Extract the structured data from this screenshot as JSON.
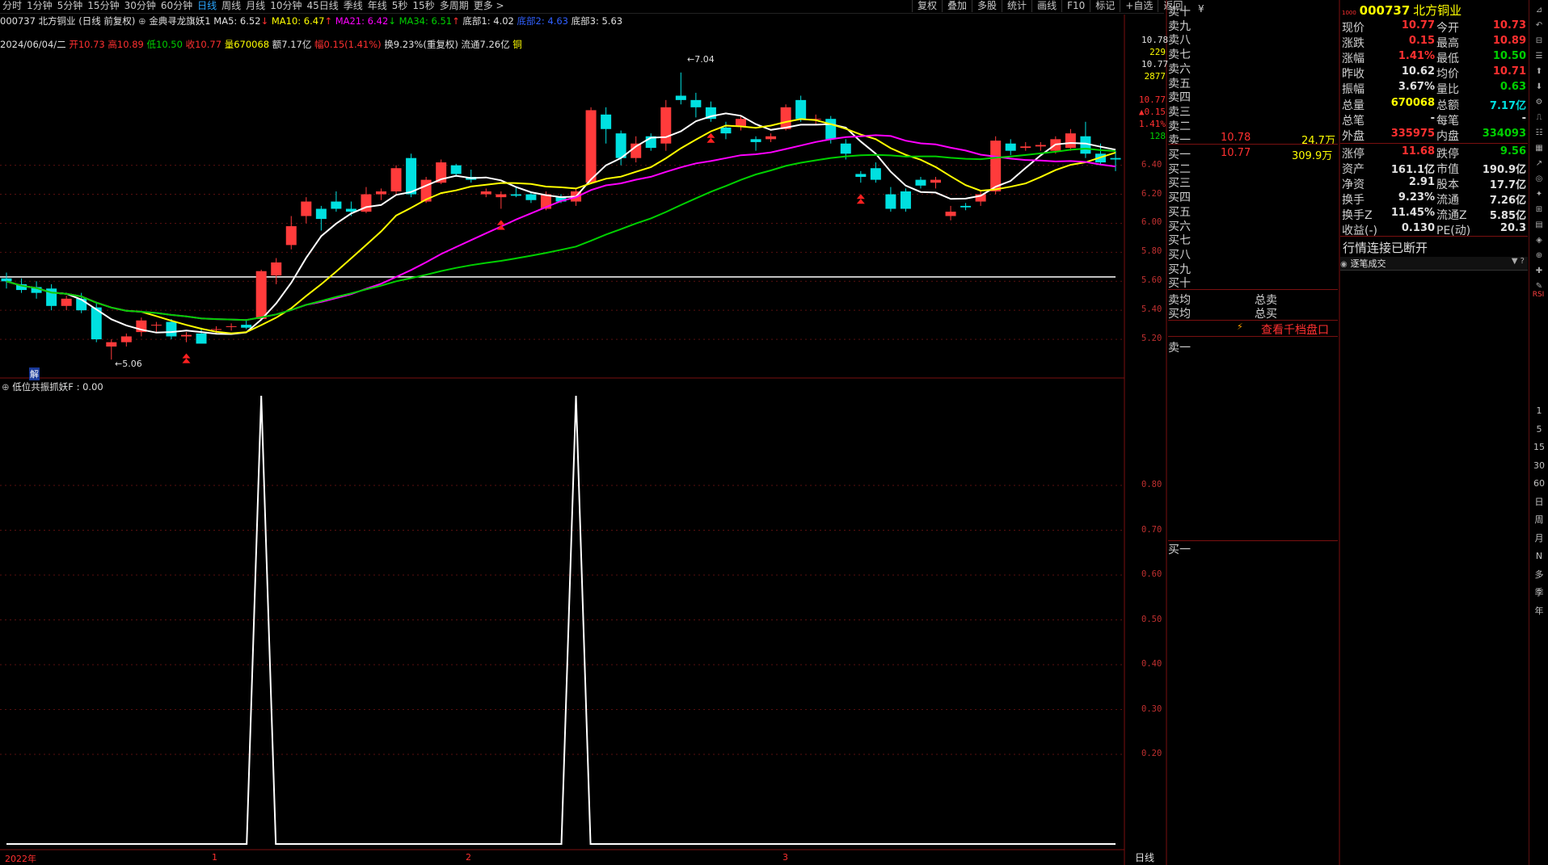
{
  "periods": [
    "分时",
    "1分钟",
    "5分钟",
    "15分钟",
    "30分钟",
    "60分钟",
    "日线",
    "周线",
    "月线",
    "10分钟",
    "45日线",
    "季线",
    "年线",
    "5秒",
    "15秒",
    "多周期",
    "更多 >"
  ],
  "active_period": "日线",
  "tools": [
    "复权",
    "叠加",
    "多股",
    "统计",
    "画线",
    "F10",
    "标记",
    "+自选",
    "返回"
  ],
  "stock": {
    "code": "000737",
    "name": "北方铜业",
    "mode": "(日线 前复权)"
  },
  "indicator_main": "金典寻龙旗妖1",
  "ma": {
    "ma5": "MA5: 6.52",
    "ma10": "MA10: 6.47",
    "ma21": "MA21: 6.42",
    "ma34": "MA34: 6.51",
    "bottom1": "底部1: 4.02",
    "bottom2": "底部2: 4.63",
    "bottom3": "底部3: 5.63"
  },
  "ohlc": {
    "date": "2024/06/04/二",
    "open": "开10.73",
    "high": "高10.89",
    "low": "低10.50",
    "close": "收10.77",
    "vol": "量670068",
    "amount": "额7.17亿",
    "change": "幅0.15(1.41%)",
    "turnover": "换9.23%(重复权)",
    "float": "流通7.26亿",
    "tag": "铜"
  },
  "price_axis": {
    "top": "10.78",
    "vol_a": "229",
    "price_b": "10.77",
    "vol_b": "2877",
    "price_c": "10.77",
    "chg": "▲0.15",
    "pct": "1.41%",
    "extra": "128",
    "ticks": [
      "6.40",
      "6.20",
      "6.00",
      "5.80",
      "5.60",
      "5.40",
      "5.20"
    ]
  },
  "annot": {
    "high": "7.04",
    "low": "5.06",
    "jie": "解"
  },
  "sub_indicator": "低位共振抓妖F : 0.00",
  "sub_axis": [
    "0.80",
    "0.70",
    "0.60",
    "0.50",
    "0.40",
    "0.30",
    "0.20"
  ],
  "date_axis": {
    "year": "2022年",
    "m1": "1",
    "m2": "2",
    "m3": "3",
    "period": "日线"
  },
  "orderbook": {
    "sells": [
      "卖十",
      "卖九",
      "卖八",
      "卖七",
      "卖六",
      "卖五",
      "卖四",
      "卖三",
      "卖二",
      "卖一"
    ],
    "sell_flag": "¥",
    "sell1_price": "10.78",
    "sell1_vol": "24.7万",
    "buys": [
      "买一",
      "买二",
      "买三",
      "买四",
      "买五",
      "买六",
      "买七",
      "买八",
      "买九",
      "买十"
    ],
    "buy1_price": "10.77",
    "buy1_vol": "309.9万",
    "avg_sell": "卖均",
    "total_sell": "总卖",
    "avg_buy": "买均",
    "total_buy": "总买",
    "thousand_link": "查看千档盘口",
    "box_sell1": "卖一",
    "box_buy1": "买一"
  },
  "quote": {
    "header_code": "000737",
    "header_name": "北方铜业",
    "rows": [
      {
        "l1": "现价",
        "v1": "10.77",
        "c1": "red",
        "l2": "今开",
        "v2": "10.73",
        "c2": "red"
      },
      {
        "l1": "涨跌",
        "v1": "0.15",
        "c1": "red",
        "l2": "最高",
        "v2": "10.89",
        "c2": "red"
      },
      {
        "l1": "涨幅",
        "v1": "1.41%",
        "c1": "red",
        "l2": "最低",
        "v2": "10.50",
        "c2": "green"
      },
      {
        "l1": "昨收",
        "v1": "10.62",
        "c1": "white",
        "l2": "均价",
        "v2": "10.71",
        "c2": "red"
      },
      {
        "l1": "振幅",
        "v1": "3.67%",
        "c1": "white",
        "l2": "量比",
        "v2": "0.63",
        "c2": "green"
      },
      {
        "l1": "总量",
        "v1": "670068",
        "c1": "yellow",
        "l2": "总额",
        "v2": "7.17亿",
        "c2": "cyan"
      },
      {
        "l1": "总笔",
        "v1": "-",
        "c1": "white",
        "l2": "每笔",
        "v2": "-",
        "c2": "white"
      },
      {
        "l1": "外盘",
        "v1": "335975",
        "c1": "red",
        "l2": "内盘",
        "v2": "334093",
        "c2": "green"
      },
      {
        "l1": "涨停",
        "v1": "11.68",
        "c1": "red",
        "l2": "跌停",
        "v2": "9.56",
        "c2": "green"
      },
      {
        "l1": "资产",
        "v1": "161.1亿",
        "c1": "white",
        "l2": "市值",
        "v2": "190.9亿",
        "c2": "white"
      },
      {
        "l1": "净资",
        "v1": "2.91",
        "c1": "white",
        "l2": "股本",
        "v2": "17.7亿",
        "c2": "white"
      },
      {
        "l1": "换手",
        "v1": "9.23%",
        "c1": "white",
        "l2": "流通",
        "v2": "7.26亿",
        "c2": "white"
      },
      {
        "l1": "换手Z",
        "v1": "11.45%",
        "c1": "white",
        "l2": "流通Z",
        "v2": "5.85亿",
        "c2": "white"
      },
      {
        "l1": "收益(-)",
        "v1": "0.130",
        "c1": "white",
        "l2": "PE(动)",
        "v2": "20.3",
        "c2": "white"
      }
    ],
    "status": "行情连接已断开",
    "trades_title": "逐笔成交"
  },
  "sidebar_icons": [
    "1",
    "5",
    "15",
    "30",
    "60",
    "日",
    "周",
    "月",
    "N",
    "多",
    "季",
    "年"
  ],
  "sidebar_misc": [
    "RSI"
  ],
  "colors": {
    "up": "#ff3b3b",
    "down": "#00e0e0",
    "ma5": "#ffffff",
    "ma10": "#ffff00",
    "ma21": "#ff00ff",
    "ma34": "#00d000",
    "grid": "#5a1010"
  },
  "chart_data": {
    "type": "candlestick",
    "candles": [
      {
        "o": 5.62,
        "h": 5.66,
        "l": 5.55,
        "c": 5.6
      },
      {
        "o": 5.58,
        "h": 5.62,
        "l": 5.52,
        "c": 5.54
      },
      {
        "o": 5.56,
        "h": 5.6,
        "l": 5.48,
        "c": 5.52
      },
      {
        "o": 5.55,
        "h": 5.58,
        "l": 5.4,
        "c": 5.43
      },
      {
        "o": 5.43,
        "h": 5.5,
        "l": 5.4,
        "c": 5.48
      },
      {
        "o": 5.48,
        "h": 5.52,
        "l": 5.38,
        "c": 5.4
      },
      {
        "o": 5.42,
        "h": 5.45,
        "l": 5.18,
        "c": 5.2
      },
      {
        "o": 5.15,
        "h": 5.2,
        "l": 5.06,
        "c": 5.18
      },
      {
        "o": 5.18,
        "h": 5.24,
        "l": 5.15,
        "c": 5.22
      },
      {
        "o": 5.25,
        "h": 5.35,
        "l": 5.22,
        "c": 5.33
      },
      {
        "o": 5.3,
        "h": 5.32,
        "l": 5.25,
        "c": 5.3
      },
      {
        "o": 5.32,
        "h": 5.34,
        "l": 5.2,
        "c": 5.22
      },
      {
        "o": 5.22,
        "h": 5.25,
        "l": 5.18,
        "c": 5.23
      },
      {
        "o": 5.24,
        "h": 5.28,
        "l": 5.17,
        "c": 5.17
      },
      {
        "o": 5.27,
        "h": 5.29,
        "l": 5.24,
        "c": 5.27
      },
      {
        "o": 5.29,
        "h": 5.31,
        "l": 5.26,
        "c": 5.29
      },
      {
        "o": 5.3,
        "h": 5.34,
        "l": 5.27,
        "c": 5.28
      },
      {
        "o": 5.34,
        "h": 5.68,
        "l": 5.33,
        "c": 5.67
      },
      {
        "o": 5.64,
        "h": 5.76,
        "l": 5.58,
        "c": 5.73
      },
      {
        "o": 5.85,
        "h": 6.05,
        "l": 5.82,
        "c": 5.98
      },
      {
        "o": 6.05,
        "h": 6.18,
        "l": 6.0,
        "c": 6.15
      },
      {
        "o": 6.1,
        "h": 6.12,
        "l": 5.95,
        "c": 6.03
      },
      {
        "o": 6.15,
        "h": 6.22,
        "l": 6.08,
        "c": 6.1
      },
      {
        "o": 6.1,
        "h": 6.15,
        "l": 6.05,
        "c": 6.08
      },
      {
        "o": 6.08,
        "h": 6.25,
        "l": 6.07,
        "c": 6.2
      },
      {
        "o": 6.2,
        "h": 6.24,
        "l": 6.16,
        "c": 6.22
      },
      {
        "o": 6.22,
        "h": 6.4,
        "l": 6.2,
        "c": 6.38
      },
      {
        "o": 6.45,
        "h": 6.48,
        "l": 6.18,
        "c": 6.2
      },
      {
        "o": 6.15,
        "h": 6.32,
        "l": 6.14,
        "c": 6.3
      },
      {
        "o": 6.28,
        "h": 6.44,
        "l": 6.27,
        "c": 6.42
      },
      {
        "o": 6.4,
        "h": 6.41,
        "l": 6.32,
        "c": 6.34
      },
      {
        "o": 6.32,
        "h": 6.37,
        "l": 6.28,
        "c": 6.3
      },
      {
        "o": 6.2,
        "h": 6.24,
        "l": 6.18,
        "c": 6.22
      },
      {
        "o": 6.18,
        "h": 6.22,
        "l": 6.1,
        "c": 6.2
      },
      {
        "o": 6.2,
        "h": 6.25,
        "l": 6.18,
        "c": 6.19
      },
      {
        "o": 6.2,
        "h": 6.22,
        "l": 6.14,
        "c": 6.16
      },
      {
        "o": 6.1,
        "h": 6.22,
        "l": 6.09,
        "c": 6.2
      },
      {
        "o": 6.18,
        "h": 6.2,
        "l": 6.14,
        "c": 6.15
      },
      {
        "o": 6.15,
        "h": 6.24,
        "l": 6.12,
        "c": 6.22
      },
      {
        "o": 6.28,
        "h": 6.8,
        "l": 6.27,
        "c": 6.78
      },
      {
        "o": 6.75,
        "h": 6.8,
        "l": 6.55,
        "c": 6.65
      },
      {
        "o": 6.62,
        "h": 6.64,
        "l": 6.4,
        "c": 6.45
      },
      {
        "o": 6.45,
        "h": 6.6,
        "l": 6.42,
        "c": 6.55
      },
      {
        "o": 6.6,
        "h": 6.62,
        "l": 6.5,
        "c": 6.52
      },
      {
        "o": 6.55,
        "h": 6.85,
        "l": 6.5,
        "c": 6.8
      },
      {
        "o": 6.88,
        "h": 7.04,
        "l": 6.82,
        "c": 6.85
      },
      {
        "o": 6.85,
        "h": 6.9,
        "l": 6.73,
        "c": 6.8
      },
      {
        "o": 6.8,
        "h": 6.84,
        "l": 6.7,
        "c": 6.72
      },
      {
        "o": 6.66,
        "h": 6.7,
        "l": 6.58,
        "c": 6.62
      },
      {
        "o": 6.67,
        "h": 6.74,
        "l": 6.64,
        "c": 6.72
      },
      {
        "o": 6.58,
        "h": 6.6,
        "l": 6.5,
        "c": 6.56
      },
      {
        "o": 6.58,
        "h": 6.62,
        "l": 6.56,
        "c": 6.6
      },
      {
        "o": 6.65,
        "h": 6.82,
        "l": 6.64,
        "c": 6.8
      },
      {
        "o": 6.85,
        "h": 6.88,
        "l": 6.7,
        "c": 6.72
      },
      {
        "o": 6.72,
        "h": 6.75,
        "l": 6.68,
        "c": 6.72
      },
      {
        "o": 6.72,
        "h": 6.74,
        "l": 6.55,
        "c": 6.58
      },
      {
        "o": 6.55,
        "h": 6.58,
        "l": 6.44,
        "c": 6.48
      },
      {
        "o": 6.34,
        "h": 6.36,
        "l": 6.28,
        "c": 6.32
      },
      {
        "o": 6.38,
        "h": 6.42,
        "l": 6.28,
        "c": 6.3
      },
      {
        "o": 6.2,
        "h": 6.25,
        "l": 6.08,
        "c": 6.1
      },
      {
        "o": 6.22,
        "h": 6.24,
        "l": 6.08,
        "c": 6.1
      },
      {
        "o": 6.3,
        "h": 6.32,
        "l": 6.24,
        "c": 6.26
      },
      {
        "o": 6.28,
        "h": 6.32,
        "l": 6.24,
        "c": 6.3
      },
      {
        "o": 6.05,
        "h": 6.12,
        "l": 6.02,
        "c": 6.08
      },
      {
        "o": 6.12,
        "h": 6.14,
        "l": 6.09,
        "c": 6.11
      },
      {
        "o": 6.15,
        "h": 6.22,
        "l": 6.12,
        "c": 6.2
      },
      {
        "o": 6.22,
        "h": 6.6,
        "l": 6.2,
        "c": 6.57
      },
      {
        "o": 6.55,
        "h": 6.58,
        "l": 6.47,
        "c": 6.5
      },
      {
        "o": 6.52,
        "h": 6.56,
        "l": 6.5,
        "c": 6.53
      },
      {
        "o": 6.53,
        "h": 6.56,
        "l": 6.5,
        "c": 6.54
      },
      {
        "o": 6.5,
        "h": 6.6,
        "l": 6.48,
        "c": 6.58
      },
      {
        "o": 6.52,
        "h": 6.65,
        "l": 6.5,
        "c": 6.62
      },
      {
        "o": 6.6,
        "h": 6.7,
        "l": 6.45,
        "c": 6.48
      },
      {
        "o": 6.48,
        "h": 6.55,
        "l": 6.4,
        "c": 6.42
      },
      {
        "o": 6.45,
        "h": 6.5,
        "l": 6.36,
        "c": 6.44
      }
    ],
    "sub_series": {
      "name": "低位共振抓妖F",
      "values": [
        0,
        0,
        0,
        0,
        0,
        0,
        0,
        0,
        0,
        0,
        0,
        0,
        0,
        0,
        0,
        0,
        0,
        1,
        0,
        0,
        0,
        0,
        0,
        0,
        0,
        0,
        0,
        0,
        0,
        0,
        0,
        0,
        0,
        0,
        0,
        0,
        0,
        0,
        1,
        0,
        0,
        0,
        0,
        0,
        0,
        0,
        0,
        0,
        0,
        0,
        0,
        0,
        0,
        0,
        0,
        0,
        0,
        0,
        0,
        0,
        0,
        0,
        0,
        0,
        0,
        0,
        0,
        0,
        0,
        0,
        0,
        0,
        0
      ]
    },
    "ylim": [
      5.06,
      7.04
    ]
  }
}
